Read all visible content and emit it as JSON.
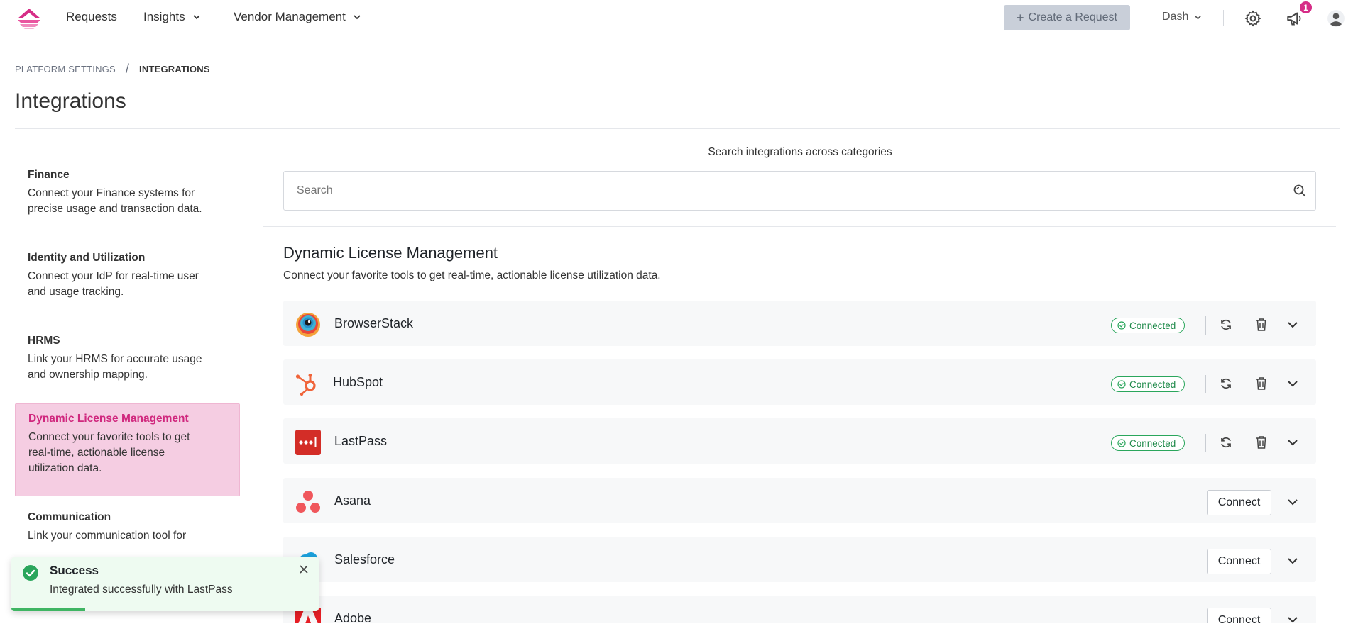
{
  "nav": {
    "items": [
      {
        "label": "Requests"
      },
      {
        "label": "Insights"
      },
      {
        "label": "Vendor Management"
      }
    ],
    "create_label": "Create a Request",
    "workspace": "Dash",
    "notification_count": "1"
  },
  "breadcrumb": {
    "parent": "PLATFORM SETTINGS",
    "separator": "/",
    "current": "INTEGRATIONS"
  },
  "page_title": "Integrations",
  "categories": [
    {
      "title": "Finance",
      "desc": "Connect your Finance systems for precise usage and transaction data."
    },
    {
      "title": "Identity and Utilization",
      "desc": "Connect your IdP for real-time user and usage tracking."
    },
    {
      "title": "HRMS",
      "desc": "Link your HRMS for accurate usage and ownership mapping."
    },
    {
      "title": "Dynamic License Management",
      "desc": "Connect your favorite tools to get real-time, actionable license utilization data."
    },
    {
      "title": "Communication",
      "desc": "Link your communication tool for"
    }
  ],
  "search": {
    "label": "Search integrations across categories",
    "placeholder": "Search",
    "value": ""
  },
  "section": {
    "title": "Dynamic License Management",
    "desc": "Connect your favorite tools to get real-time, actionable license utilization data."
  },
  "integrations": [
    {
      "name": "BrowserStack",
      "status": "Connected"
    },
    {
      "name": "HubSpot",
      "status": "Connected"
    },
    {
      "name": "LastPass",
      "status": "Connected"
    },
    {
      "name": "Asana",
      "action": "Connect"
    },
    {
      "name": "Salesforce",
      "action": "Connect"
    },
    {
      "name": "Adobe",
      "action": "Connect"
    }
  ],
  "toast": {
    "title": "Success",
    "message": "Integrated successfully with LastPass",
    "progress": 0.24
  },
  "colors": {
    "brand": "#d62d87",
    "active_bg": "#f5cde2",
    "connected": "#2aa65c",
    "success": "#3fb563"
  }
}
